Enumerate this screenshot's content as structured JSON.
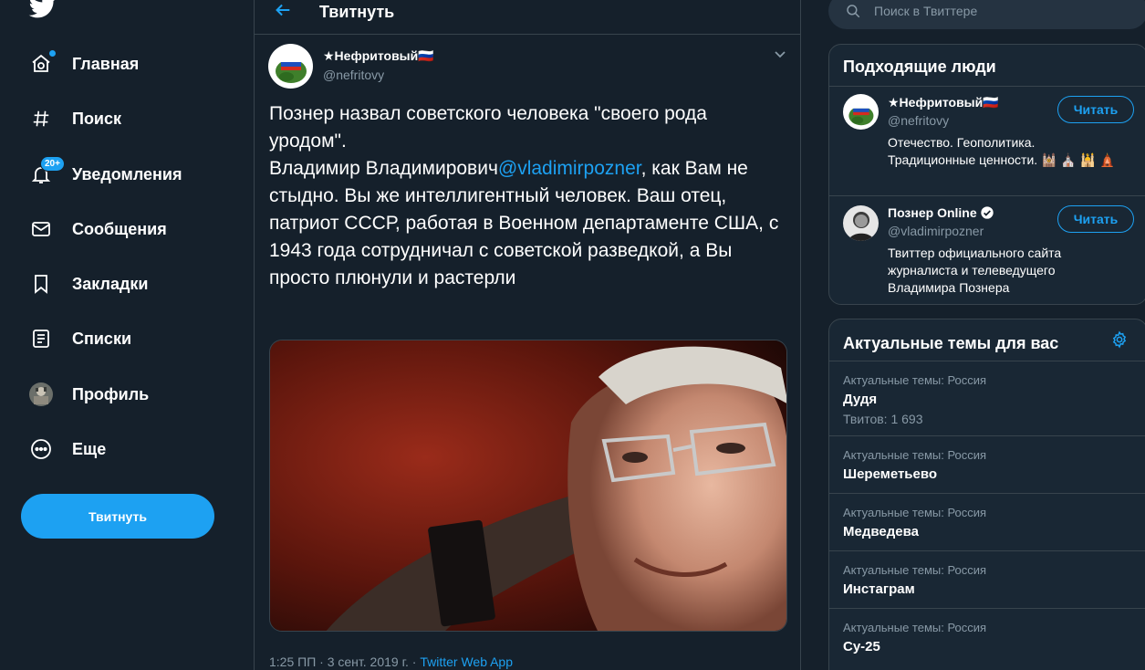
{
  "nav": {
    "items": [
      {
        "label": "Главная",
        "icon": "home-icon"
      },
      {
        "label": "Поиск",
        "icon": "hashtag-icon"
      },
      {
        "label": "Уведомления",
        "icon": "bell-icon",
        "badge": "20+"
      },
      {
        "label": "Сообщения",
        "icon": "mail-icon"
      },
      {
        "label": "Закладки",
        "icon": "bookmark-icon"
      },
      {
        "label": "Списки",
        "icon": "list-icon"
      },
      {
        "label": "Профиль",
        "icon": "profile-avatar"
      },
      {
        "label": "Еще",
        "icon": "more-icon"
      }
    ],
    "tweet_button": "Твитнуть"
  },
  "header": {
    "title": "Твитнуть"
  },
  "tweet": {
    "author_name": "★Нефритовый🇷🇺",
    "author_handle": "@nefritovy",
    "text_before_mention": "Познер назвал советского человека \"своего рода уродом\".\nВладимир Владимирович",
    "mention": "@vladimirpozner",
    "text_after_mention": ", как Вам не стыдно. Вы же интеллигентный человек. Ваш отец, патриот СССР, работая в Военном департаменте США, с 1943 года сотрудничал с советской разведкой, а Вы просто плюнули и растерли",
    "time": "1:25 ПП",
    "separator": "·",
    "date": "3 сент. 2019 г.",
    "source": "Twitter Web App"
  },
  "search": {
    "placeholder": "Поиск в Твиттере"
  },
  "who_to_follow": {
    "title": "Подходящие люди",
    "users": [
      {
        "name": "★Нефритовый🇷🇺",
        "handle": "@nefritovy",
        "bio": "Отечество. Геополитика. Традиционные ценности. 🕍 ⛪ 🕌 🛕",
        "follow": "Читать",
        "verified": false
      },
      {
        "name": "Познер Online",
        "handle": "@vladimirpozner",
        "bio": "Твиттер официального сайта журналиста и телеведущего Владимира Познера",
        "follow": "Читать",
        "verified": true
      }
    ]
  },
  "trends": {
    "title": "Актуальные темы для вас",
    "items": [
      {
        "meta": "Актуальные темы: Россия",
        "name": "Дудя",
        "count": "Твитов: 1 693"
      },
      {
        "meta": "Актуальные темы: Россия",
        "name": "Шереметьево",
        "count": ""
      },
      {
        "meta": "Актуальные темы: Россия",
        "name": "Медведева",
        "count": ""
      },
      {
        "meta": "Актуальные темы: Россия",
        "name": "Инстаграм",
        "count": ""
      },
      {
        "meta": "Актуальные темы: Россия",
        "name": "Су-25",
        "count": ""
      }
    ]
  },
  "colors": {
    "background": "#15202b",
    "panel": "#192734",
    "accent": "#1da1f2",
    "border": "#38444d",
    "secondary_text": "#8899a6"
  }
}
